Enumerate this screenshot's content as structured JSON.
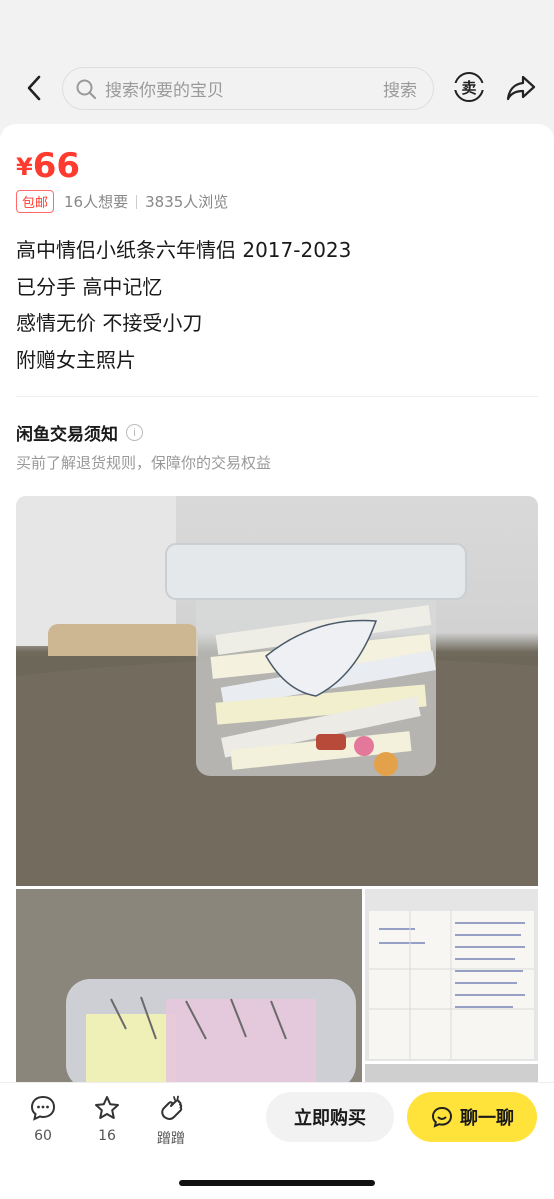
{
  "header": {
    "back_icon": "chevron-left-icon",
    "search_placeholder": "搜索你要的宝贝",
    "search_button": "搜索",
    "sell_label": "卖",
    "share_icon": "share-arrow-icon"
  },
  "product": {
    "currency": "¥",
    "price": "66",
    "badge": "包邮",
    "wants": "16人想要",
    "views": "3835人浏览",
    "description": [
      "高中情侣小纸条六年情侣 2017-2023",
      "已分手 高中记忆",
      "感情无价 不接受小刀",
      "附赠女主照片"
    ]
  },
  "notice": {
    "title": "闲鱼交易须知",
    "subtitle": "买前了解退货规则，保障你的交易权益"
  },
  "bottom": {
    "comment_count": "60",
    "star_count": "16",
    "nudge_label": "蹭蹭",
    "buy_label": "立即购买",
    "chat_label": "聊一聊"
  },
  "colors": {
    "price": "#ff3b30",
    "chat_button": "#ffe23a",
    "buy_button": "#f2f2f2"
  }
}
